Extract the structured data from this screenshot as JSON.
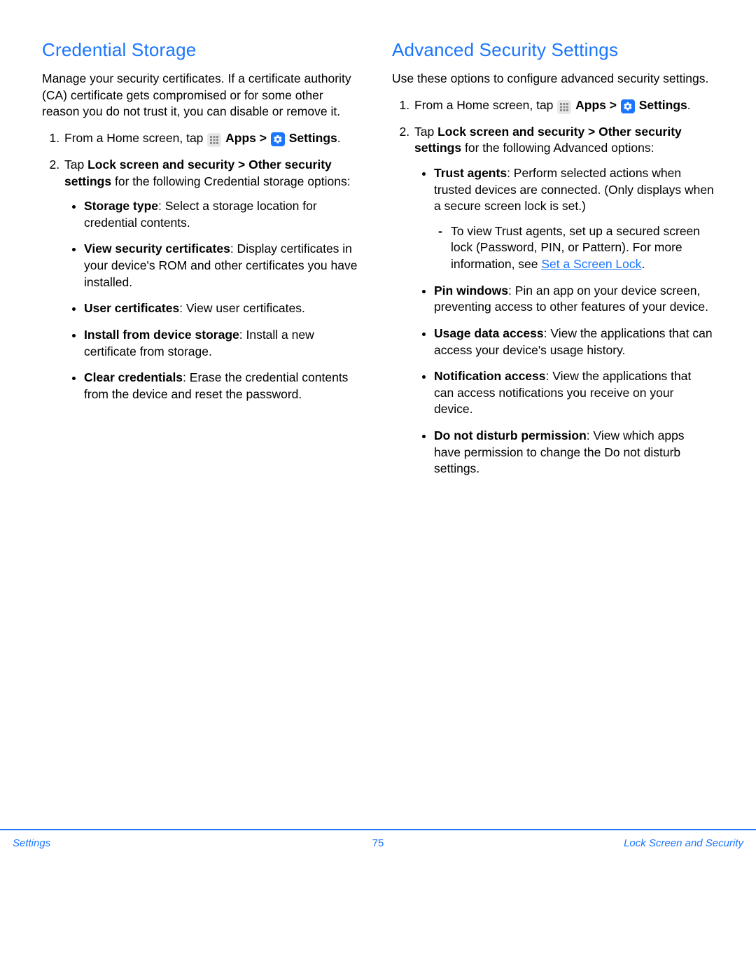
{
  "left": {
    "heading": "Credential Storage",
    "intro": "Manage your security certificates. If a certificate authority (CA) certificate gets compromised or for some other reason you do not trust it, you can disable or remove it.",
    "step1_a": "From a Home screen, tap ",
    "step1_apps": "Apps",
    "step1_gt": " > ",
    "step1_settings": "Settings",
    "step1_dot": ".",
    "step2_a": "Tap ",
    "step2_b": "Lock screen and security > Other security settings",
    "step2_c": " for the following Credential storage options:",
    "bullets": [
      {
        "term": "Storage type",
        "desc": ": Select a storage location for credential contents."
      },
      {
        "term": "View security certificates",
        "desc": ": Display certificates in your device's ROM and other certificates you have installed."
      },
      {
        "term": "User certificates",
        "desc": ": View user certificates."
      },
      {
        "term": "Install from device storage",
        "desc": ": Install a new certificate from storage."
      },
      {
        "term": "Clear credentials",
        "desc": ": Erase the credential contents from the device and reset the password."
      }
    ]
  },
  "right": {
    "heading": "Advanced Security Settings",
    "intro": "Use these options to configure advanced security settings.",
    "step1_a": "From a Home screen, tap ",
    "step1_apps": "Apps",
    "step1_gt": " > ",
    "step1_settings": "Settings",
    "step1_dot": ".",
    "step2_a": "Tap ",
    "step2_b": "Lock screen and security > Other security settings",
    "step2_c": " for the following Advanced options:",
    "trust_term": "Trust agents",
    "trust_desc": ": Perform selected actions when trusted devices are connected. (Only displays when a secure screen lock is set.)",
    "trust_sub_a": "To view Trust agents, set up a secured screen lock (Password, PIN, or Pattern). For more information, see ",
    "trust_sub_link": "Set a Screen Lock",
    "trust_sub_dot": ".",
    "bullets_rest": [
      {
        "term": "Pin windows",
        "desc": ": Pin an app on your device screen, preventing access to other features of your device."
      },
      {
        "term": "Usage data access",
        "desc": ": View the applications that can access your device's usage history."
      },
      {
        "term": "Notification access",
        "desc": ": View the applications that can access notifications you receive on your device."
      },
      {
        "term": "Do not disturb permission",
        "desc": ": View which apps have permission to change the Do not disturb settings."
      }
    ]
  },
  "footer": {
    "left": "Settings",
    "center": "75",
    "right": "Lock Screen and Security"
  }
}
